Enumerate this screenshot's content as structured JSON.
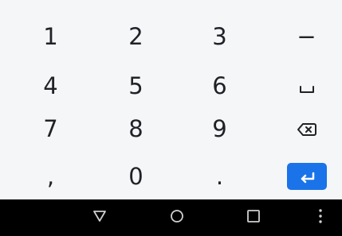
{
  "keyboard": {
    "keys": {
      "one": "1",
      "two": "2",
      "three": "3",
      "minus": "−",
      "four": "4",
      "five": "5",
      "six": "6",
      "seven": "7",
      "eight": "8",
      "nine": "9",
      "comma": ",",
      "zero": "0",
      "period": "."
    },
    "icons": {
      "space": "space-icon",
      "backspace": "backspace-icon",
      "enter": "enter-icon"
    },
    "colors": {
      "background": "#f5f6f8",
      "key_text": "#1f2226",
      "enter_accent": "#1a73e8"
    }
  },
  "navigation_bar": {
    "icons": {
      "back": "back-triangle-icon",
      "home": "home-circle-icon",
      "recents": "recents-square-icon",
      "menu": "menu-dots-icon"
    },
    "colors": {
      "background": "#000000",
      "icon": "#d0d0d0"
    }
  }
}
